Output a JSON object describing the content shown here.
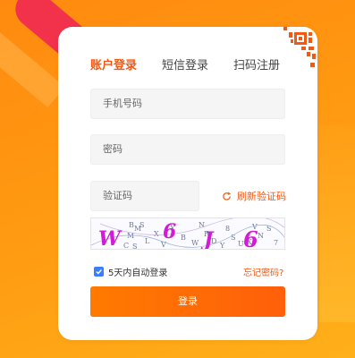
{
  "tabs": [
    {
      "label": "账户登录",
      "active": true
    },
    {
      "label": "短信登录",
      "active": false
    },
    {
      "label": "扫码注册",
      "active": false
    }
  ],
  "form": {
    "phone_placeholder": "手机号码",
    "password_placeholder": "密码",
    "captcha_placeholder": "验证码",
    "refresh_captcha_label": "刷新验证码",
    "captcha_text": "W6J6",
    "remember_label": "5天内自动登录",
    "remember_checked": true,
    "forgot_label": "忘记密码?",
    "login_button_label": "登录"
  },
  "colors": {
    "accent": "#f05a14",
    "button": "#ff6a00",
    "background": "#ff9c12",
    "checkbox": "#3b7dff",
    "captcha_text": "#d11bd6"
  }
}
